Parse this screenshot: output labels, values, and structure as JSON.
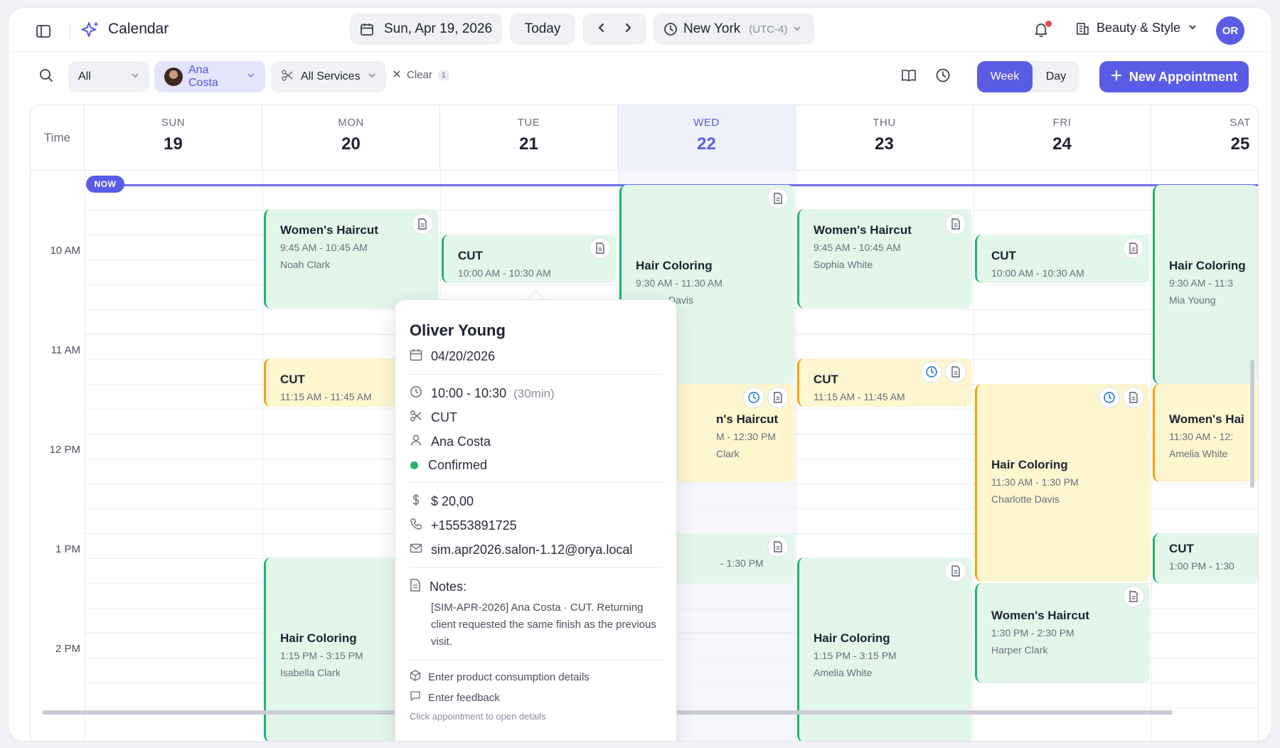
{
  "header": {
    "app_title": "Calendar",
    "date_label": "Sun, Apr 19, 2026",
    "today_label": "Today",
    "timezone_city": "New York",
    "timezone_offset": "(UTC-4)",
    "business_name": "Beauty & Style",
    "user_initials": "OR"
  },
  "toolbar": {
    "filter_all": "All",
    "filter_staff": "Ana Costa",
    "filter_services": "All Services",
    "clear_label": "Clear",
    "clear_count": "1",
    "view_week": "Week",
    "view_day": "Day",
    "new_appointment": "New Appointment"
  },
  "calendar": {
    "time_header": "Time",
    "now_label": "NOW",
    "days": [
      {
        "dow": "SUN",
        "num": "19"
      },
      {
        "dow": "MON",
        "num": "20"
      },
      {
        "dow": "TUE",
        "num": "21"
      },
      {
        "dow": "WED",
        "num": "22"
      },
      {
        "dow": "THU",
        "num": "23"
      },
      {
        "dow": "FRI",
        "num": "24"
      },
      {
        "dow": "SAT",
        "num": "25"
      }
    ],
    "time_labels": [
      "10 AM",
      "11 AM",
      "12 PM",
      "1 PM",
      "2 PM"
    ],
    "appointments": [
      {
        "service": "Women's Haircut",
        "time": "9:45 AM - 10:45 AM",
        "client": "Noah Clark"
      },
      {
        "service": "CUT",
        "time": "11:15 AM - 11:45 AM",
        "client": ""
      },
      {
        "service": "Hair Coloring",
        "time": "1:15 PM - 3:15 PM",
        "client": "Isabella Clark"
      },
      {
        "service": "CUT",
        "time": "10:00 AM - 10:30 AM",
        "client": ""
      },
      {
        "service": "Hair Coloring",
        "time": "9:30 AM - 11:30 AM",
        "client": "Davis"
      },
      {
        "service": "n's Haircut",
        "time": "M - 12:30 PM",
        "client": "Clark"
      },
      {
        "service": "",
        "time": "- 1:30 PM",
        "client": ""
      },
      {
        "service": "Women's Haircut",
        "time": "9:45 AM - 10:45 AM",
        "client": "Sophia White"
      },
      {
        "service": "CUT",
        "time": "11:15 AM - 11:45 AM",
        "client": ""
      },
      {
        "service": "Hair Coloring",
        "time": "1:15 PM - 3:15 PM",
        "client": "Amelia White"
      },
      {
        "service": "CUT",
        "time": "10:00 AM - 10:30 AM",
        "client": ""
      },
      {
        "service": "Hair Coloring",
        "time": "11:30 AM - 1:30 PM",
        "client": "Charlotte Davis"
      },
      {
        "service": "Women's Haircut",
        "time": "1:30 PM - 2:30 PM",
        "client": "Harper Clark"
      },
      {
        "service": "Hair Coloring",
        "time": "9:30 AM - 11:3",
        "client": "Mia Young"
      },
      {
        "service": "Women's Hai",
        "time": "11:30 AM - 12:",
        "client": "Amelia White"
      },
      {
        "service": "CUT",
        "time": "1:00 PM - 1:30",
        "client": ""
      }
    ]
  },
  "popover": {
    "client_name": "Oliver Young",
    "date": "04/20/2026",
    "time_range": "10:00 - 10:30",
    "duration": "(30min)",
    "service": "CUT",
    "staff": "Ana Costa",
    "status": "Confirmed",
    "price": "$ 20,00",
    "phone": "+15553891725",
    "email": "sim.apr2026.salon-1.12@orya.local",
    "notes_label": "Notes:",
    "notes_text": "[SIM-APR-2026] Ana Costa · CUT. Returning client requested the same finish as the previous visit.",
    "product_link": "Enter product consumption details",
    "feedback_link": "Enter feedback",
    "hint": "Click appointment to open details"
  },
  "colors": {
    "accent": "#5b5ce6",
    "green_block": "#e2f7ea",
    "green_border": "#22b36a",
    "yellow_block": "#fdf6cf",
    "yellow_border": "#f0a30a",
    "status_confirmed": "#22b36a",
    "notification_dot": "#e5484d"
  }
}
